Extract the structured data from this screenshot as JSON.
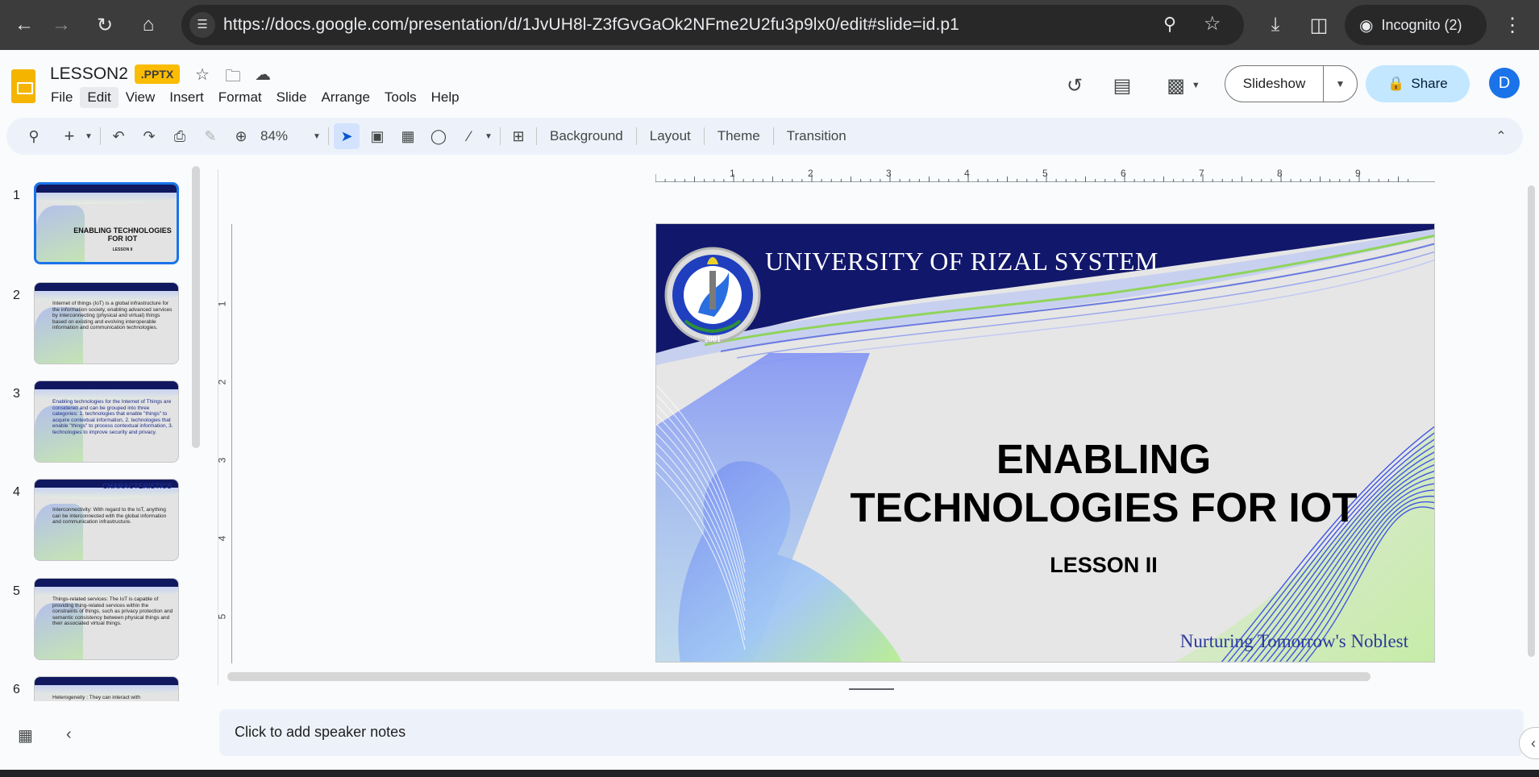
{
  "browser": {
    "url": "https://docs.google.com/presentation/d/1JvUH8l-Z3fGvGaOk2NFme2U2fu3p9lx0/edit#slide=id.p1",
    "incognito_label": "Incognito (2)"
  },
  "doc": {
    "title": "LESSON2",
    "badge": ".PPTX"
  },
  "menu": [
    "File",
    "Edit",
    "View",
    "Insert",
    "Format",
    "Slide",
    "Arrange",
    "Tools",
    "Help"
  ],
  "header_actions": {
    "slideshow_label": "Slideshow",
    "share_label": "Share",
    "avatar_initial": "D"
  },
  "toolbar": {
    "zoom": "84%",
    "background": "Background",
    "layout": "Layout",
    "theme": "Theme",
    "transition": "Transition"
  },
  "filmstrip": {
    "slides": [
      {
        "num": "1",
        "text": "ENABLING TECHNOLOGIES FOR IOT",
        "sub": "LESSON II"
      },
      {
        "num": "2",
        "text": "Internet of things (IoT) is a global infrastructure for the information society, enabling advanced services by interconnecting (physical and virtual) things based on existing and evolving interoperable information and communication technologies."
      },
      {
        "num": "3",
        "text": "Enabling technologies for the Internet of Things are considered and can be grouped into three categories: 1. technologies that enable \"things\" to acquire contextual information, 2. technologies that enable \"things\" to process contextual information, 3. technologies to improve security and privacy."
      },
      {
        "num": "4",
        "heading": "CHARACTERISTICS",
        "text": "Interconnectivity: With regard to the IoT, anything can be interconnected with the global information and communication infrastructure."
      },
      {
        "num": "5",
        "text": "Things-related services: The IoT is capable of providing thing-related services within the constraints of things, such as privacy protection and semantic consistency between physical things and their associated virtual things."
      },
      {
        "num": "6",
        "text": "Heterogeneity : They can interact with"
      }
    ]
  },
  "ruler": {
    "h_ticks": [
      "1",
      "2",
      "3",
      "4",
      "5",
      "6",
      "7",
      "8",
      "9"
    ],
    "v_ticks": [
      "1",
      "2",
      "3",
      "4",
      "5"
    ]
  },
  "slide": {
    "university": "UNIVERSITY OF RIZAL SYSTEM",
    "title_line1": "ENABLING",
    "title_line2": "TECHNOLOGIES FOR IOT",
    "subtitle": "LESSON II",
    "motto": "Nurturing Tomorrow's Noblest",
    "seal_year": "2001"
  },
  "notes": {
    "placeholder": "Click to add speaker notes"
  }
}
